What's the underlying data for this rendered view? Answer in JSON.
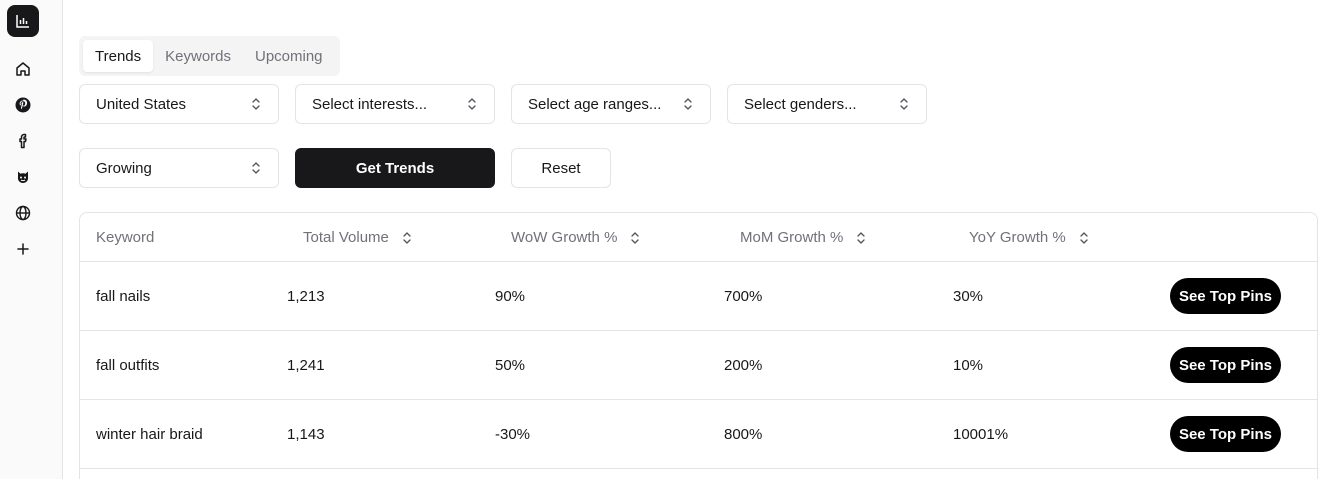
{
  "sidebar": {
    "logo_icon": "bar-chart-icon",
    "items": [
      {
        "icon": "home-icon"
      },
      {
        "icon": "pinterest-icon"
      },
      {
        "icon": "facebook-icon"
      },
      {
        "icon": "reddit-icon"
      },
      {
        "icon": "globe-icon"
      },
      {
        "icon": "plus-icon"
      }
    ]
  },
  "tabs": [
    {
      "label": "Trends",
      "active": true
    },
    {
      "label": "Keywords",
      "active": false
    },
    {
      "label": "Upcoming",
      "active": false
    }
  ],
  "filters": {
    "country": "United States",
    "interests": "Select interests...",
    "age_ranges": "Select age ranges...",
    "genders": "Select genders...",
    "trend_type": "Growing"
  },
  "actions": {
    "get_trends": "Get Trends",
    "reset": "Reset"
  },
  "table": {
    "columns": {
      "keyword": "Keyword",
      "total_volume": "Total Volume",
      "wow": "WoW Growth %",
      "mom": "MoM Growth %",
      "yoy": "YoY Growth %"
    },
    "action_label": "See Top Pins",
    "rows": [
      {
        "keyword": "fall nails",
        "volume": "1,213",
        "wow": "90%",
        "mom": "700%",
        "yoy": "30%"
      },
      {
        "keyword": "fall outfits",
        "volume": "1,241",
        "wow": "50%",
        "mom": "200%",
        "yoy": "10%"
      },
      {
        "keyword": "winter hair braid",
        "volume": "1,143",
        "wow": "-30%",
        "mom": "800%",
        "yoy": "10001%"
      }
    ]
  },
  "colors": {
    "primary": "#18181b",
    "border": "#e4e4e7",
    "muted_text": "#71717a",
    "pill_button": "#000000"
  }
}
